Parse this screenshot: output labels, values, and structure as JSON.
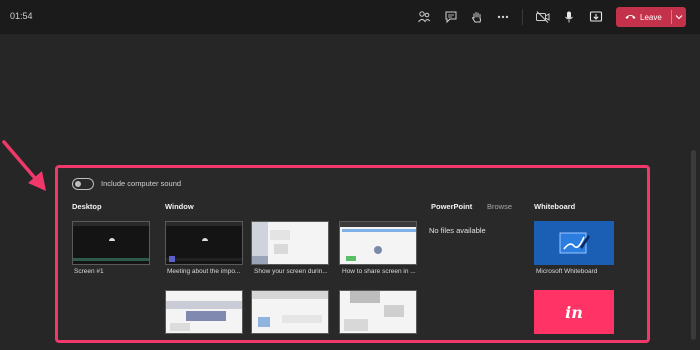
{
  "topbar": {
    "time": "01:54",
    "icons": [
      "people-icon",
      "chat-icon",
      "raise-hand-icon",
      "more-icon",
      "camera-off-icon",
      "mic-icon",
      "share-icon"
    ],
    "leave_label": "Leave",
    "leave_color": "#c4314b"
  },
  "share_panel": {
    "border_color": "#f0386b",
    "include_sound_label": "Include computer sound",
    "include_sound_on": false,
    "sections": {
      "desktop": {
        "title": "Desktop",
        "items": [
          {
            "caption": "Screen #1"
          }
        ]
      },
      "window": {
        "title": "Window",
        "items": [
          {
            "caption": "Meeting about the impo..."
          },
          {
            "caption": "Show your screen durin..."
          },
          {
            "caption": "How to share screen in ..."
          },
          {
            "caption": ""
          },
          {
            "caption": ""
          },
          {
            "caption": ""
          }
        ]
      },
      "powerpoint": {
        "title": "PowerPoint",
        "browse_label": "Browse",
        "empty_text": "No files available"
      },
      "whiteboard": {
        "title": "Whiteboard",
        "items": [
          {
            "caption": "Microsoft Whiteboard",
            "color": "#1a5fb4"
          },
          {
            "caption": "",
            "logo_text": "in",
            "color": "#ff3366"
          }
        ]
      }
    }
  }
}
